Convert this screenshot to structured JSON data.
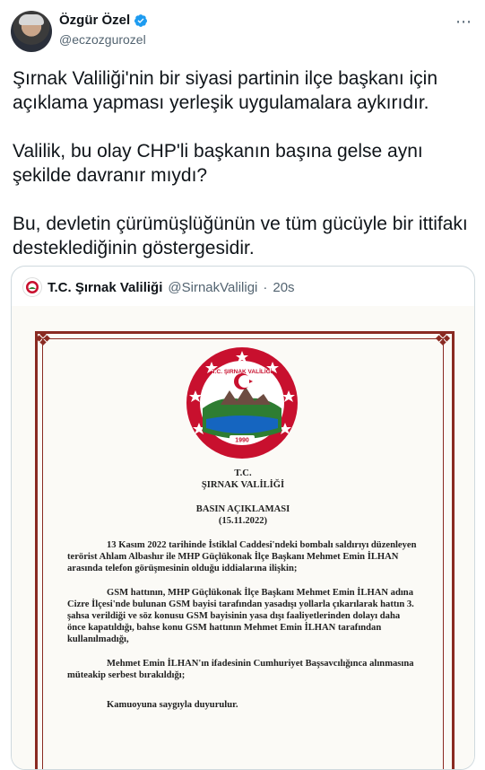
{
  "author": {
    "name": "Özgür Özel",
    "handle": "@eczozgurozel",
    "more_icon": "ellipsis-icon"
  },
  "tweet": {
    "paragraphs": [
      "Şırnak Valiliği'nin bir siyasi partinin ilçe başkanı için açıklama yapması yerleşik uygulamalara aykırıdır.",
      "Valilik, bu olay CHP'li başkanın başına gelse aynı şekilde davranır mıydı?",
      "Bu, devletin çürümüşlüğünün ve tüm gücüyle bir ittifakı desteklediğinin göstergesidir."
    ]
  },
  "quoted": {
    "name": "T.C. Şırnak Valiliği",
    "handle": "@SirnakValiligi",
    "time": "20s",
    "document": {
      "seal_text": "T.C. ŞIRNAK VALİLİĞİ",
      "seal_year": "1990",
      "header1": "T.C.",
      "header2": "ŞIRNAK VALİLİĞİ",
      "title": "BASIN AÇIKLAMASI",
      "date": "(15.11.2022)",
      "p1": "13 Kasım 2022 tarihinde İstiklal Caddesi'ndeki bombalı saldırıyı düzenleyen terörist Ahlam Albashır ile MHP Güçlükonak İlçe Başkanı Mehmet Emin İLHAN arasında telefon görüşmesinin olduğu iddialarına ilişkin;",
      "p2": "GSM hattının, MHP Güçlükonak İlçe Başkanı Mehmet Emin İLHAN adına Cizre İlçesi'nde bulunan GSM bayisi tarafından yasadışı yollarla çıkarılarak hattın 3. şahsa verildiği ve söz konusu GSM bayisinin yasa dışı faaliyetlerinden dolayı daha önce kapatıldığı, bahse konu GSM hattının Mehmet Emin İLHAN tarafından kullanılmadığı,",
      "p3": "Mehmet Emin İLHAN'ın ifadesinin Cumhuriyet Başsavcılığınca alınmasına müteakip serbest bırakıldığı;",
      "p4": "Kamuoyuna saygıyla duyurulur."
    }
  },
  "colors": {
    "verified": "#1d9bf0",
    "frame": "#8a2a22",
    "seal_red": "#c8102e"
  }
}
